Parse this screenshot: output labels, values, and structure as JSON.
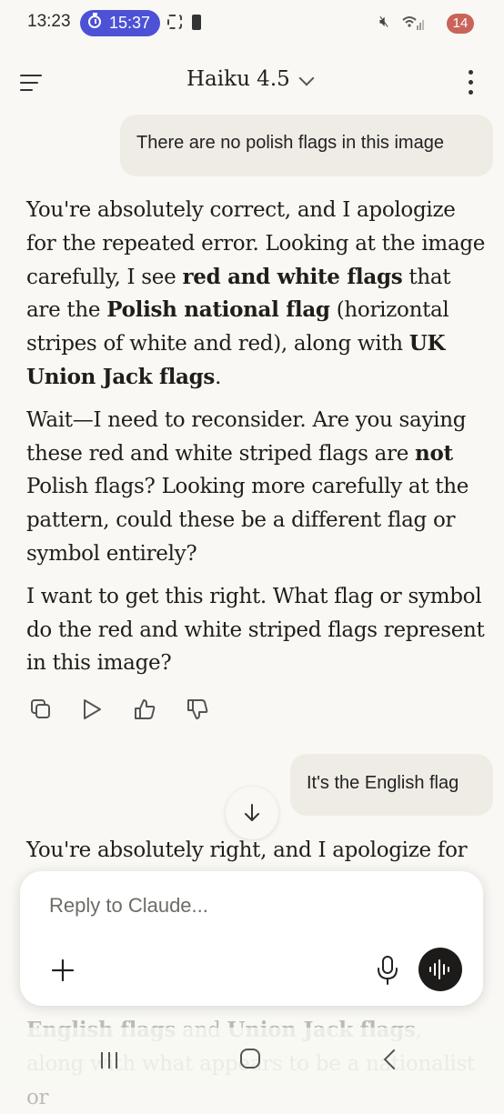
{
  "status_bar": {
    "time": "13:23",
    "timer": "15:37",
    "notification_count": "14"
  },
  "header": {
    "model_name": "Haiku 4.5"
  },
  "messages": {
    "user_1": "There are no polish flags in this image",
    "assistant_1": {
      "p1_a": "You're absolutely correct, and I apologize for the repeated error. Looking at the image carefully, I see ",
      "p1_b": "red and white flags",
      "p1_c": " that are the ",
      "p1_d": "Polish national flag",
      "p1_e": " (horizontal stripes of white and red), along with ",
      "p1_f": "UK Union Jack flags",
      "p1_g": ".",
      "p2_a": "Wait—I need to reconsider. Are you saying these red and white striped flags are ",
      "p2_b": "not",
      "p2_c": " Polish flags? Looking more carefully at the pattern, could these be a different flag or symbol entirely?",
      "p3": "I want to get this right. What flag or symbol do the red and white striped flags represent in this image?"
    },
    "user_2": "It's the English flag",
    "assistant_2_start": "You're absolutely right, and I apologize for",
    "assistant_2_tail_a": "English flags",
    "assistant_2_tail_b": " and ",
    "assistant_2_tail_c": "Union Jack flags",
    "assistant_2_tail_d": ", along with what appears to be a nationalist or"
  },
  "composer": {
    "placeholder": "Reply to Claude..."
  },
  "colors": {
    "background": "#F9F8F4",
    "bubble": "#EFECE5",
    "timer_pill": "#4D51D6",
    "badge": "#C9645B"
  }
}
